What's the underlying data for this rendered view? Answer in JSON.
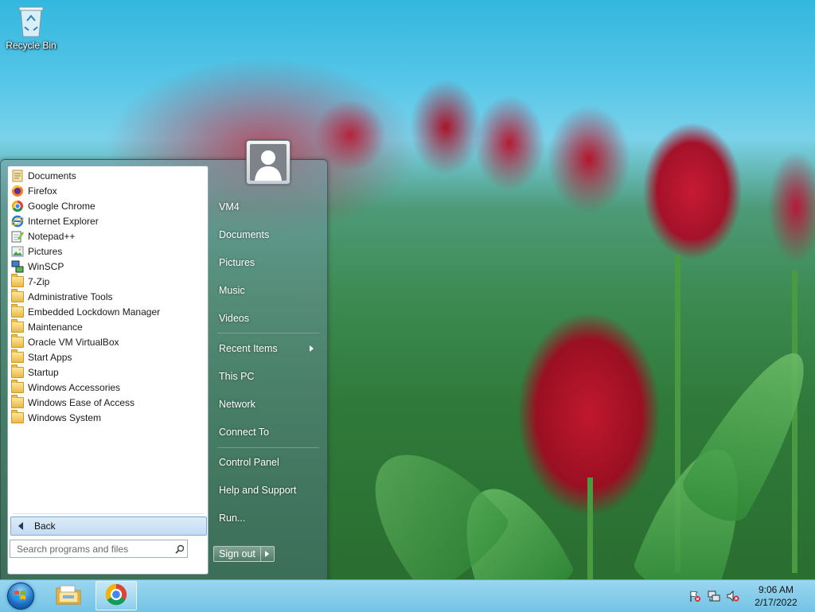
{
  "desktop": {
    "icons": [
      {
        "label": "Recycle Bin",
        "icon": "recycle-bin-icon"
      }
    ]
  },
  "start_menu": {
    "programs": [
      {
        "label": "Documents",
        "icon": "documents-icon"
      },
      {
        "label": "Firefox",
        "icon": "firefox-icon"
      },
      {
        "label": "Google Chrome",
        "icon": "chrome-icon"
      },
      {
        "label": "Internet Explorer",
        "icon": "internet-explorer-icon"
      },
      {
        "label": "Notepad++",
        "icon": "notepad-plus-plus-icon"
      },
      {
        "label": "Pictures",
        "icon": "pictures-icon"
      },
      {
        "label": "WinSCP",
        "icon": "winscp-icon"
      },
      {
        "label": "7-Zip",
        "icon": "folder-icon"
      },
      {
        "label": "Administrative Tools",
        "icon": "folder-icon"
      },
      {
        "label": "Embedded Lockdown Manager",
        "icon": "folder-icon"
      },
      {
        "label": "Maintenance",
        "icon": "folder-icon"
      },
      {
        "label": "Oracle VM VirtualBox",
        "icon": "folder-icon"
      },
      {
        "label": "Start Apps",
        "icon": "folder-icon"
      },
      {
        "label": "Startup",
        "icon": "folder-icon"
      },
      {
        "label": "Windows Accessories",
        "icon": "folder-icon"
      },
      {
        "label": "Windows Ease of Access",
        "icon": "folder-icon"
      },
      {
        "label": "Windows System",
        "icon": "folder-icon"
      }
    ],
    "back_label": "Back",
    "search_placeholder": "Search programs and files",
    "right_items": {
      "user": "VM4",
      "documents": "Documents",
      "pictures": "Pictures",
      "music": "Music",
      "videos": "Videos",
      "recent_items": "Recent Items",
      "this_pc": "This PC",
      "network": "Network",
      "connect_to": "Connect To",
      "control_panel": "Control Panel",
      "help_support": "Help and Support",
      "run": "Run..."
    },
    "sign_out_label": "Sign out"
  },
  "taskbar": {
    "pinned": [
      {
        "name": "File Explorer",
        "icon": "file-explorer-icon"
      },
      {
        "name": "Google Chrome",
        "icon": "chrome-icon"
      }
    ],
    "tray_icons": [
      "action-center-flag-icon",
      "network-icon",
      "volume-muted-icon"
    ],
    "clock": {
      "time": "9:06 AM",
      "date": "2/17/2022"
    }
  },
  "colors": {
    "taskbar": "#8fd0ec",
    "menu_selection": "#c4dcf3"
  }
}
